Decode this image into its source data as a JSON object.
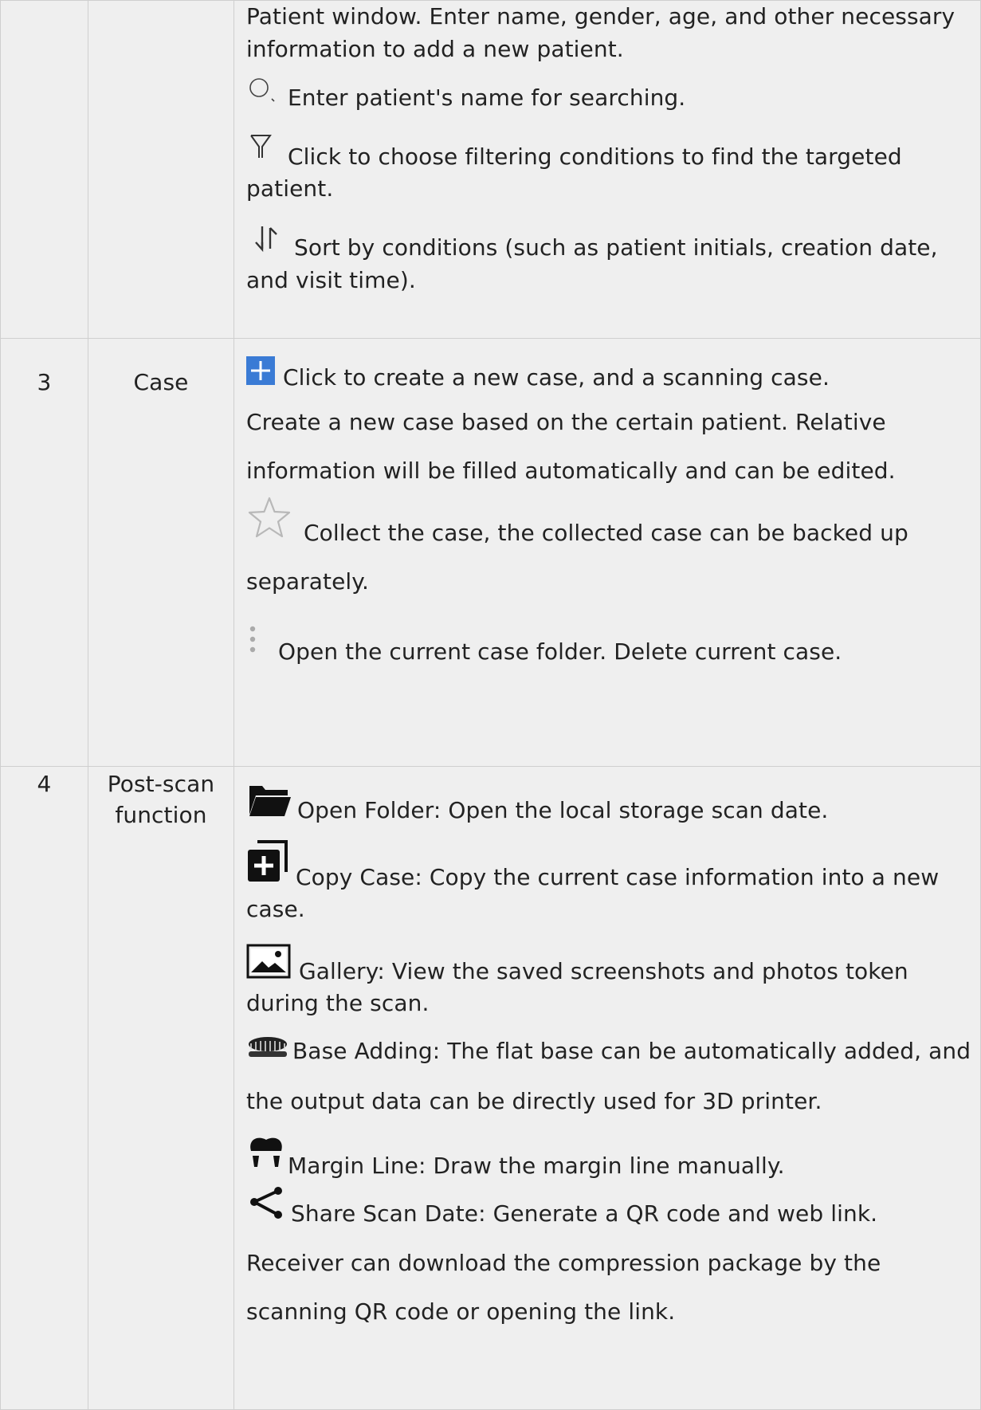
{
  "rows": [
    {
      "num": "",
      "name": "",
      "lines": {
        "intro": "Patient window. Enter name, gender, age, and other necessary information to add a new patient.",
        "search": "Enter patient's name for searching.",
        "filter": "Click to choose filtering conditions to find the targeted patient.",
        "sort": "Sort by conditions (such as patient initials, creation date, and visit time)."
      },
      "icons": {
        "search": "search-icon",
        "filter": "filter-icon",
        "sort": "sort-icon"
      }
    },
    {
      "num": "3",
      "name": "Case",
      "lines": {
        "new_case": "Click to create a new case, and a scanning case.",
        "create_text": "Create a new case based on the certain patient. Relative information will be filled automatically and can be edited.",
        "collect": "Collect the case, the collected case can be backed up separately.",
        "more": "Open the current case folder. Delete current case."
      },
      "icons": {
        "new_case": "plus-icon",
        "collect": "star-icon",
        "more": "more-vertical-icon"
      },
      "colors": {
        "plus_icon_bg": "#3a7bd5"
      }
    },
    {
      "num": "4",
      "name": "Post-scan function",
      "lines": {
        "open_folder": "Open Folder: Open the local storage scan date.",
        "copy_case": "Copy Case: Copy the current case information into a new case.",
        "gallery": "Gallery: View the saved screenshots and photos token during the scan.",
        "base_adding": "Base Adding: The flat base can be automatically added, and the output data can be directly used for 3D printer.",
        "margin_line": "Margin Line: Draw the margin line manually.",
        "share": "Share Scan Date: Generate a QR code and web link. Receiver can download the compression package by the scanning QR code or opening the link."
      },
      "icons": {
        "open_folder": "folder-icon",
        "copy_case": "copy-plus-icon",
        "gallery": "image-icon",
        "base_adding": "dental-base-icon",
        "margin_line": "tooth-icon",
        "share": "share-icon"
      }
    }
  ]
}
